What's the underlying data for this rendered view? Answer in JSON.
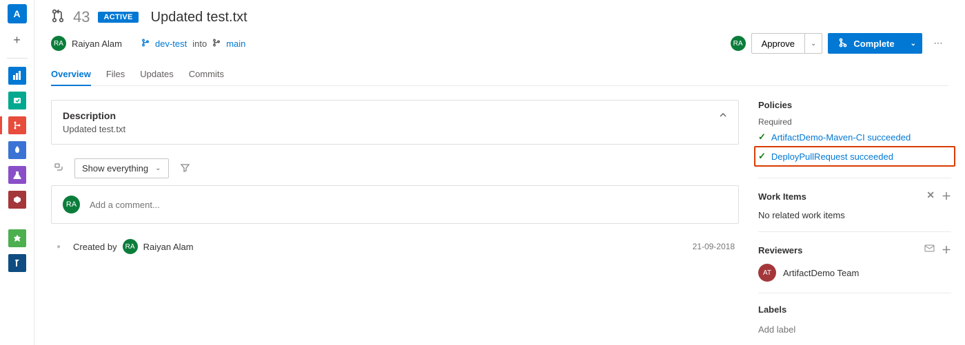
{
  "leftnav": {
    "project_letter": "A",
    "add": "+"
  },
  "header": {
    "pr_number": "43",
    "status_badge": "ACTIVE",
    "title": "Updated test.txt",
    "author_initials": "RA",
    "author_name": "Raiyan Alam",
    "source_branch": "dev-test",
    "into_label": "into",
    "target_branch": "main",
    "current_user_initials": "RA",
    "approve_label": "Approve",
    "complete_label": "Complete"
  },
  "tabs": {
    "items": [
      "Overview",
      "Files",
      "Updates",
      "Commits"
    ],
    "active_index": 0
  },
  "description": {
    "title": "Description",
    "body": "Updated test.txt"
  },
  "filter": {
    "selected": "Show everything"
  },
  "comment": {
    "avatar_initials": "RA",
    "placeholder": "Add a comment..."
  },
  "activity": {
    "created_by_label": "Created by",
    "created_by_initials": "RA",
    "created_by_name": "Raiyan Alam",
    "date": "21-09-2018"
  },
  "policies": {
    "title": "Policies",
    "required_label": "Required",
    "items": [
      {
        "text": "ArtifactDemo-Maven-CI succeeded",
        "highlighted": false
      },
      {
        "text": "DeployPullRequest succeeded",
        "highlighted": true
      }
    ]
  },
  "workitems": {
    "title": "Work Items",
    "empty": "No related work items"
  },
  "reviewers": {
    "title": "Reviewers",
    "initials": "AT",
    "name": "ArtifactDemo Team"
  },
  "labels": {
    "title": "Labels",
    "placeholder": "Add label"
  }
}
